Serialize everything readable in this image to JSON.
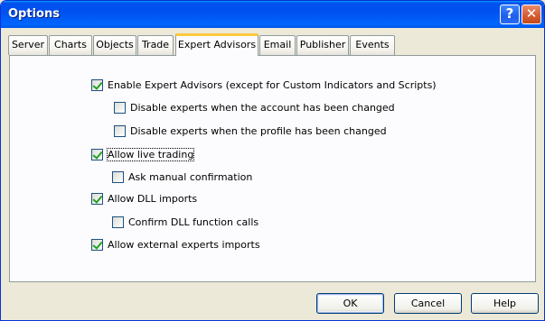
{
  "window": {
    "title": "Options",
    "help_glyph": "?",
    "close_glyph": "✕"
  },
  "tabs": [
    {
      "label": "Server"
    },
    {
      "label": "Charts"
    },
    {
      "label": "Objects"
    },
    {
      "label": "Trade"
    },
    {
      "label": "Expert Advisors",
      "active": true
    },
    {
      "label": "Email"
    },
    {
      "label": "Publisher"
    },
    {
      "label": "Events"
    }
  ],
  "options": [
    {
      "label": "Enable Expert Advisors (except for Custom Indicators and Scripts)",
      "checked": true
    },
    {
      "label": "Disable experts when the account has been changed",
      "checked": false
    },
    {
      "label": "Disable experts when the profile has been changed",
      "checked": false
    },
    {
      "label": "Allow live trading",
      "checked": true
    },
    {
      "label": "Ask manual confirmation",
      "checked": false
    },
    {
      "label": "Allow DLL imports",
      "checked": true
    },
    {
      "label": "Confirm DLL function calls",
      "checked": false
    },
    {
      "label": "Allow external experts imports",
      "checked": true
    }
  ],
  "buttons": {
    "ok": "OK",
    "cancel": "Cancel",
    "help": "Help"
  }
}
